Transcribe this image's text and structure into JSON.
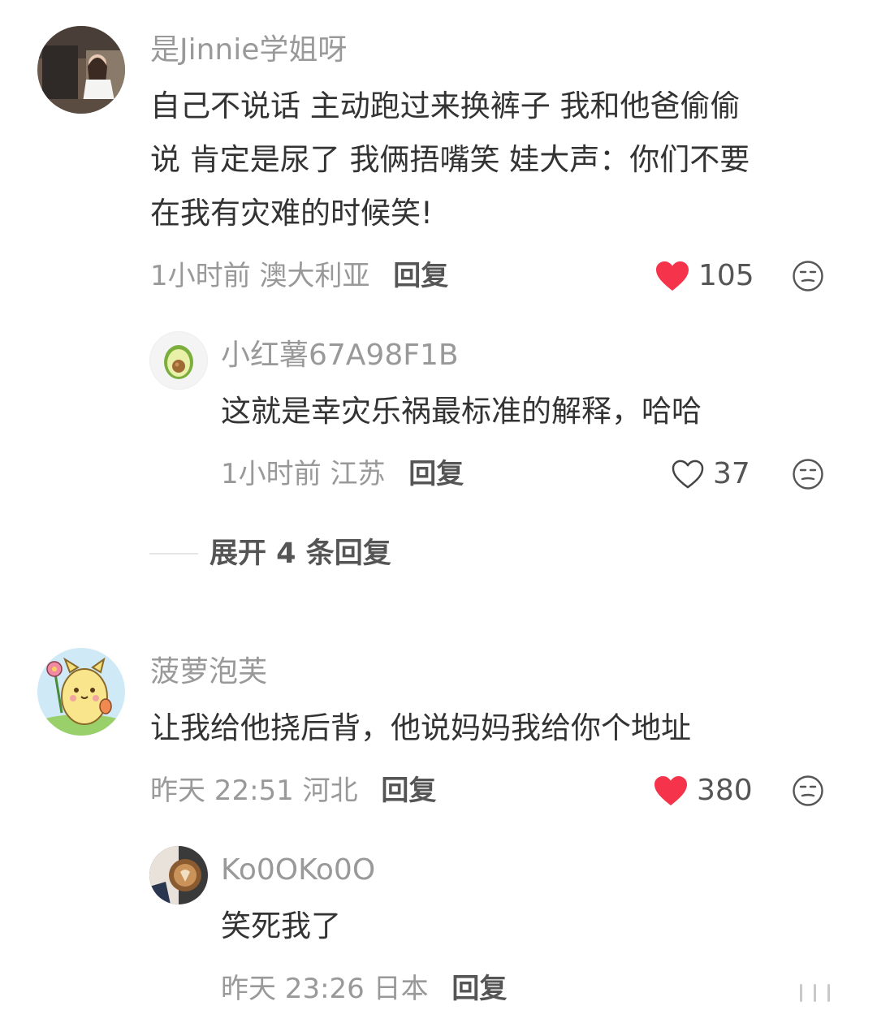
{
  "comments": [
    {
      "username": "是Jinnie学姐呀",
      "text_lines": [
        "自己不说话 主动跑过来换裤子 我和他爸偷偷",
        "说 肯定是尿了 我俩捂嘴笑 娃大声：你们不要",
        "在我有灾难的时候笑!"
      ],
      "time_location": "1小时前 澳大利亚",
      "reply_label": "回复",
      "likes": "105",
      "liked": true,
      "replies": [
        {
          "username": "小红薯67A98F1B",
          "text": "这就是幸灾乐祸最标准的解释，哈哈",
          "time_location": "1小时前 江苏",
          "reply_label": "回复",
          "likes": "37",
          "liked": false
        }
      ],
      "expand_label": "展开 4 条回复"
    },
    {
      "username": "菠萝泡芙",
      "text": "让我给他挠后背，他说妈妈我给你个地址",
      "time_location": "昨天 22:51 河北",
      "reply_label": "回复",
      "likes": "380",
      "liked": true,
      "replies": [
        {
          "username": "Ko0OKo0O",
          "text": "笑死我了",
          "time_location": "昨天 23:26 日本",
          "reply_label": "回复"
        }
      ]
    }
  ],
  "colors": {
    "like_red": "#f5334a",
    "username_gray": "#999999",
    "text_dark": "#333333"
  },
  "icons": {
    "like": "heart-icon",
    "emoji": "neutral-face-icon"
  }
}
